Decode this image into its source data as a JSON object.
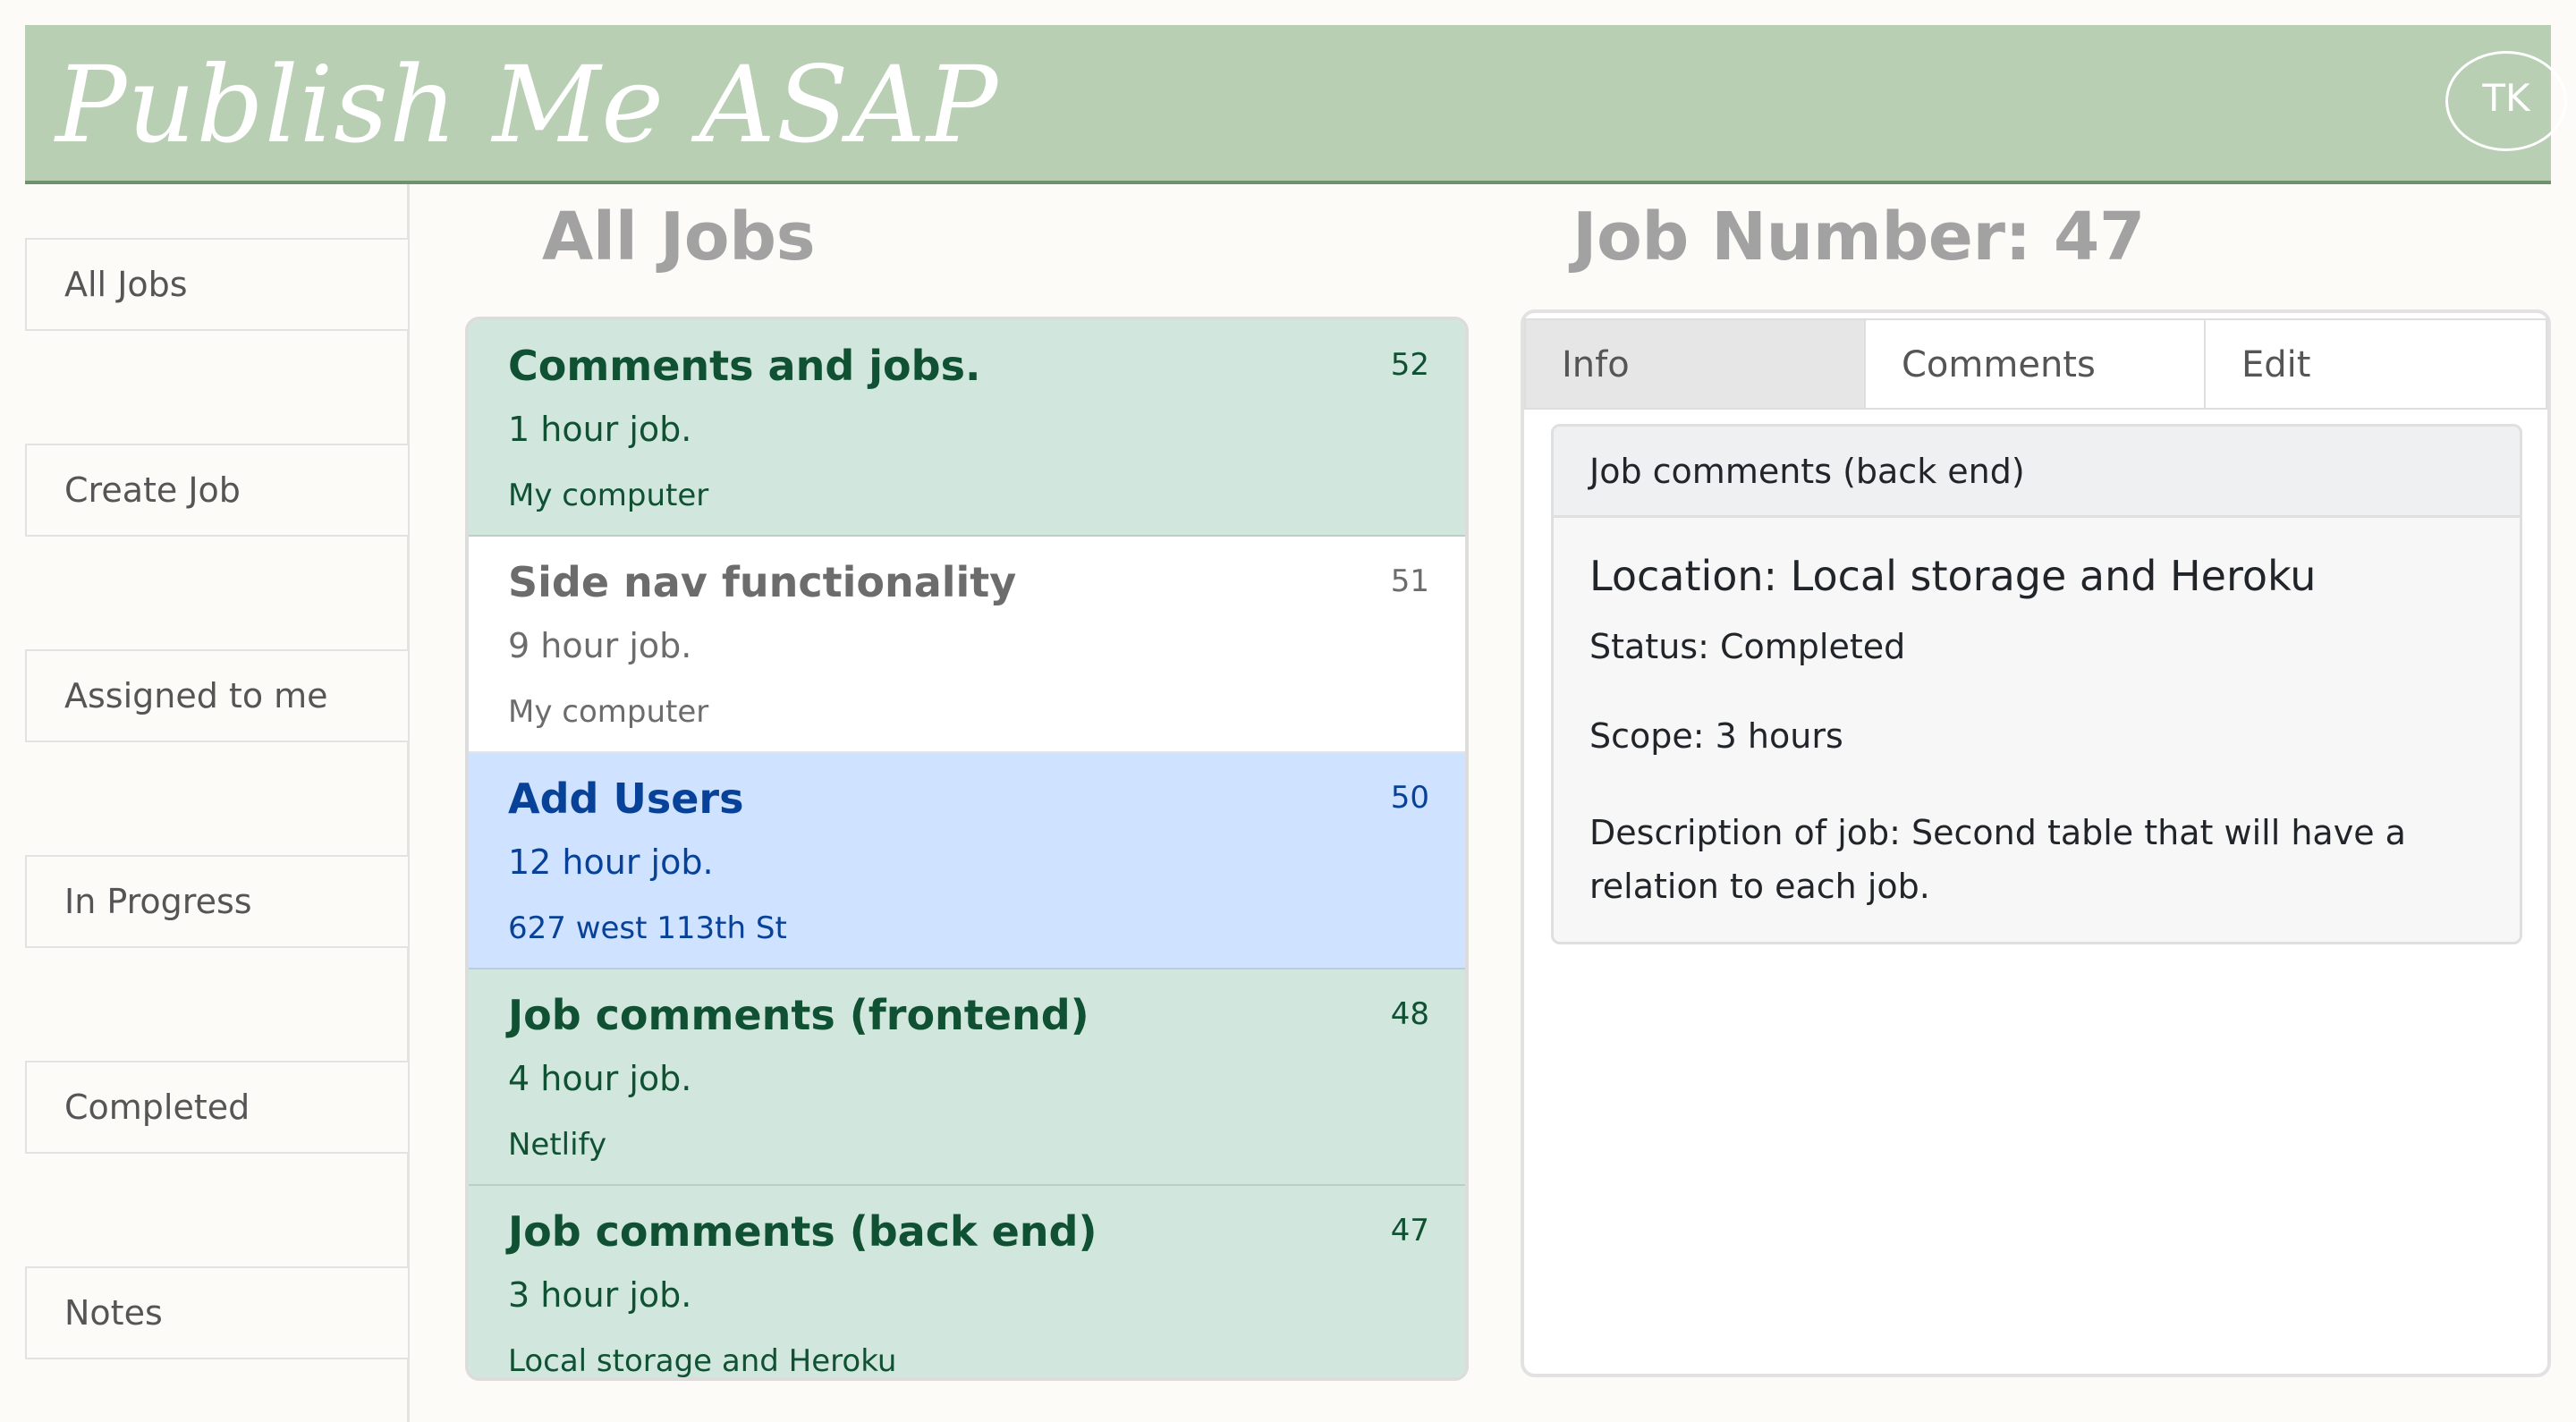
{
  "header": {
    "brand": "Publish Me ASAP",
    "avatar_initials": "TK"
  },
  "sidebar": {
    "items": [
      {
        "label": "All Jobs"
      },
      {
        "label": "Create Job"
      },
      {
        "label": "Assigned to me"
      },
      {
        "label": "In Progress"
      },
      {
        "label": "Completed"
      },
      {
        "label": "Notes"
      }
    ]
  },
  "jobs": {
    "title": "All Jobs",
    "items": [
      {
        "title": "Comments and jobs.",
        "hours": "1 hour job.",
        "location": "My computer",
        "number": "52",
        "style": "green"
      },
      {
        "title": "Side nav functionality",
        "hours": "9 hour job.",
        "location": "My computer",
        "number": "51",
        "style": "white"
      },
      {
        "title": "Add Users",
        "hours": "12 hour job.",
        "location": "627 west 113th St",
        "number": "50",
        "style": "blue"
      },
      {
        "title": "Job comments (frontend)",
        "hours": "4 hour job.",
        "location": "Netlify",
        "number": "48",
        "style": "green"
      },
      {
        "title": "Job comments (back end)",
        "hours": "3 hour job.",
        "location": "Local storage and Heroku",
        "number": "47",
        "style": "green"
      }
    ]
  },
  "detail": {
    "title": "Job Number: 47",
    "tabs": [
      {
        "label": "Info",
        "active": true
      },
      {
        "label": "Comments"
      },
      {
        "label": "Edit"
      }
    ],
    "card": {
      "header": "Job comments (back end)",
      "location": "Location: Local storage and Heroku",
      "status": "Status: Completed",
      "scope": "Scope: 3 hours",
      "description": "Description of job: Second table that will have a relation to each job."
    }
  },
  "colors": {
    "header_bg": "#b8cfb4",
    "green_item_bg": "#d1e7dd",
    "green_item_text": "#0f5132",
    "blue_item_bg": "#cfe2ff",
    "blue_item_text": "#084298"
  }
}
